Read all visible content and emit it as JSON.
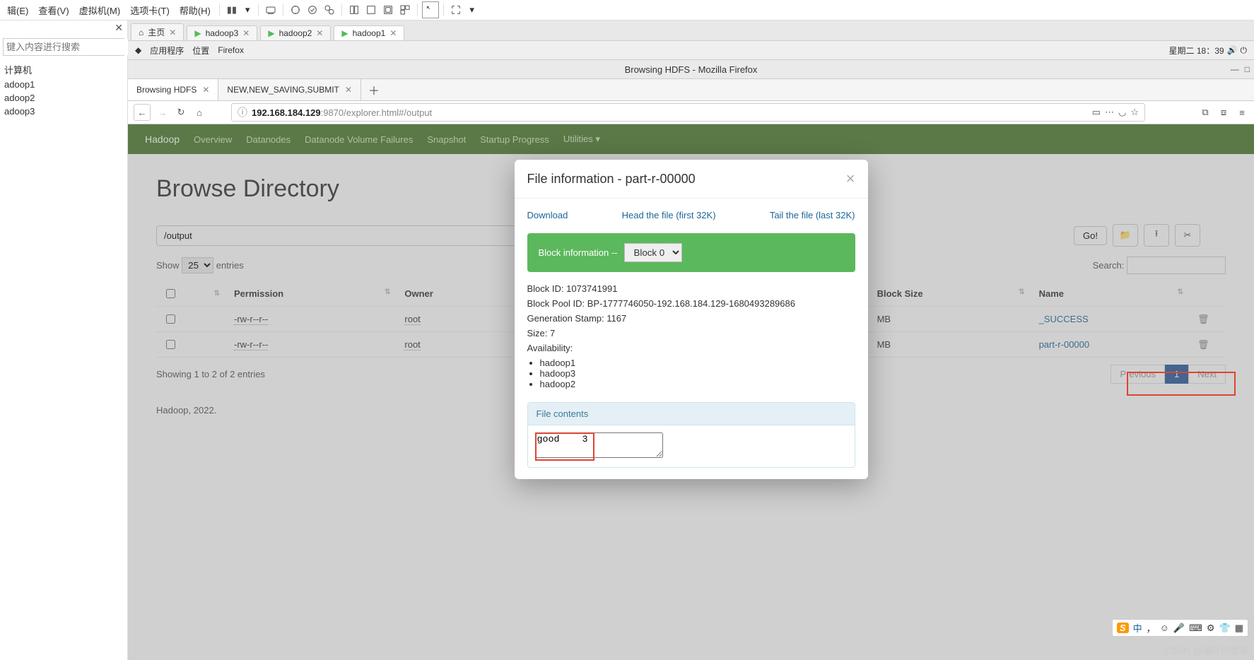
{
  "host_menu": {
    "items": [
      "辑(E)",
      "查看(V)",
      "虚拟机(M)",
      "选项卡(T)",
      "帮助(H)"
    ],
    "btn_dropdown": "▾"
  },
  "sidebar": {
    "close_x": "✕",
    "search_placeholder": "键入内容进行搜索",
    "caret": "▾",
    "root": "计算机",
    "nodes": [
      "adoop1",
      "adoop2",
      "adoop3"
    ]
  },
  "app_tabs": [
    {
      "label": "主页",
      "active": false,
      "home": true
    },
    {
      "label": "hadoop3",
      "active": false
    },
    {
      "label": "hadoop2",
      "active": false
    },
    {
      "label": "hadoop1",
      "active": true
    }
  ],
  "close_x": "✕",
  "desktop": {
    "apps": "应用程序",
    "places": "位置",
    "firefox": "Firefox",
    "clock": "星期二 18：39"
  },
  "firefox": {
    "title": "Browsing HDFS - Mozilla Firefox",
    "win_min": "—",
    "win_max": "□",
    "tabs": [
      {
        "label": "Browsing HDFS",
        "active": true
      },
      {
        "label": "NEW,NEW_SAVING,SUBMIT",
        "active": false
      }
    ],
    "tab_x": "✕",
    "plus": "＋",
    "nav": {
      "back": "←",
      "fwd": "→",
      "reload": "↻",
      "home": "⌂"
    },
    "url_info": "ⓘ",
    "url_host": "192.168.184.129",
    "url_port_path": ":9870/explorer.html#/output",
    "addr_icons": {
      "reader": "▭",
      "more": "⋯",
      "pocket": "◡",
      "star": "☆"
    },
    "far_right": {
      "sidebar": "⧉",
      "lib": "⧈",
      "menu": "≡"
    }
  },
  "hadoop_nav": {
    "brand": "Hadoop",
    "items": [
      "Overview",
      "Datanodes",
      "Datanode Volume Failures",
      "Snapshot",
      "Startup Progress",
      "Utilities ▾"
    ]
  },
  "browse": {
    "heading": "Browse Directory",
    "path": "/output",
    "go": "Go!",
    "show_l": "Show",
    "show_r": "entries",
    "show_v": "25",
    "search_l": "Search:",
    "cols": [
      "",
      "",
      "Permission",
      "Owner",
      "Block Size",
      "Name"
    ],
    "rows": [
      {
        "perm": "-rw-r--r--",
        "owner": "root",
        "bsize": "MB",
        "name": "_SUCCESS"
      },
      {
        "perm": "-rw-r--r--",
        "owner": "root",
        "bsize": "MB",
        "name": "part-r-00000"
      }
    ],
    "info": "Showing 1 to 2 of 2 entries",
    "prev": "Previous",
    "page": "1",
    "next": "Next",
    "footer": "Hadoop, 2022."
  },
  "modal": {
    "title": "File information - part-r-00000",
    "close": "×",
    "download": "Download",
    "head": "Head the file (first 32K)",
    "tail": "Tail the file (last 32K)",
    "block_label": "Block information --",
    "block_sel": "Block 0",
    "block_id_l": "Block ID: ",
    "block_id_v": "1073741991",
    "pool_l": "Block Pool ID: ",
    "pool_v": "BP-1777746050-192.168.184.129-1680493289686",
    "gen_l": "Generation Stamp: ",
    "gen_v": "1167",
    "size_l": "Size: ",
    "size_v": "7",
    "avail": "Availability:",
    "nodes": [
      "hadoop1",
      "hadoop3",
      "hadoop2"
    ],
    "fc_head": "File contents",
    "fc_body": "good    3"
  },
  "ime": {
    "s": "S",
    "cn": "中",
    "punc": "，",
    "face": "☺",
    "mic": "🎤",
    "kb": "⌨",
    "tools": "⚙",
    "shirt": "👕",
    "grid": "▦"
  },
  "watermark": "CSDN @落叶的悲哀"
}
